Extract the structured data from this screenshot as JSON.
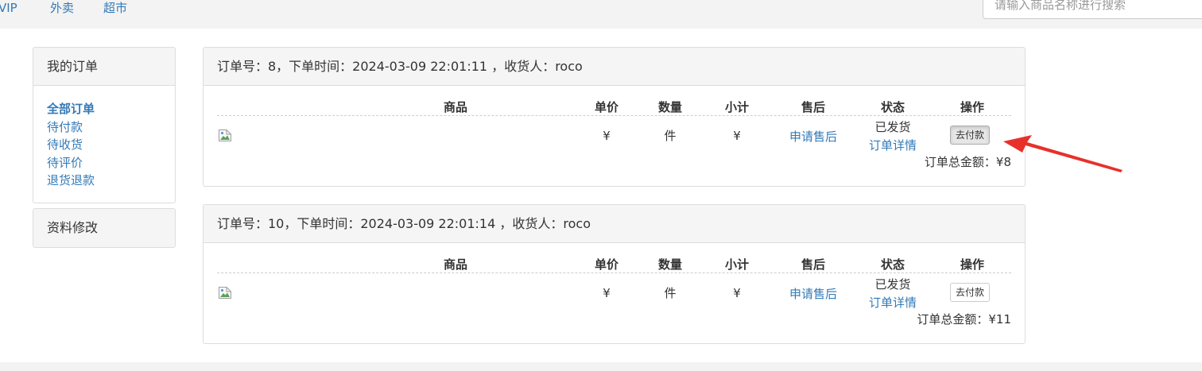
{
  "topnav": [
    "VIP",
    "外卖",
    "超市"
  ],
  "search": {
    "placeholder": "请输入商品名称进行搜索"
  },
  "sidebar": {
    "title": "我的订单",
    "items": [
      {
        "label": "全部订单",
        "active": true
      },
      {
        "label": "待付款",
        "active": false
      },
      {
        "label": "待收货",
        "active": false
      },
      {
        "label": "待评价",
        "active": false
      },
      {
        "label": "退货退款",
        "active": false
      }
    ],
    "profile_title": "资料修改"
  },
  "columns": [
    "商品",
    "单价",
    "数量",
    "小计",
    "售后",
    "状态",
    "操作"
  ],
  "orders": [
    {
      "header": "订单号：8，下单时间：2024-03-09 22:01:11 ，收货人：roco",
      "price": "¥",
      "quantity": "件",
      "subtotal": "¥",
      "aftersale": "申请售后",
      "status": "已发货",
      "detail": "订单详情",
      "action": "去付款",
      "total": "订单总金额：¥8",
      "action_pressed": true
    },
    {
      "header": "订单号：10，下单时间：2024-03-09 22:01:14 ，收货人：roco",
      "price": "¥",
      "quantity": "件",
      "subtotal": "¥",
      "aftersale": "申请售后",
      "status": "已发货",
      "detail": "订单详情",
      "action": "去付款",
      "total": "订单总金额：¥11",
      "action_pressed": false
    }
  ],
  "colors": {
    "link": "#337ab7",
    "annotation_arrow": "#e8302b",
    "panel_heading": "#f5f5f5"
  },
  "icons": {
    "product_image": "broken-image-icon",
    "annotation": "red-arrow-icon"
  }
}
